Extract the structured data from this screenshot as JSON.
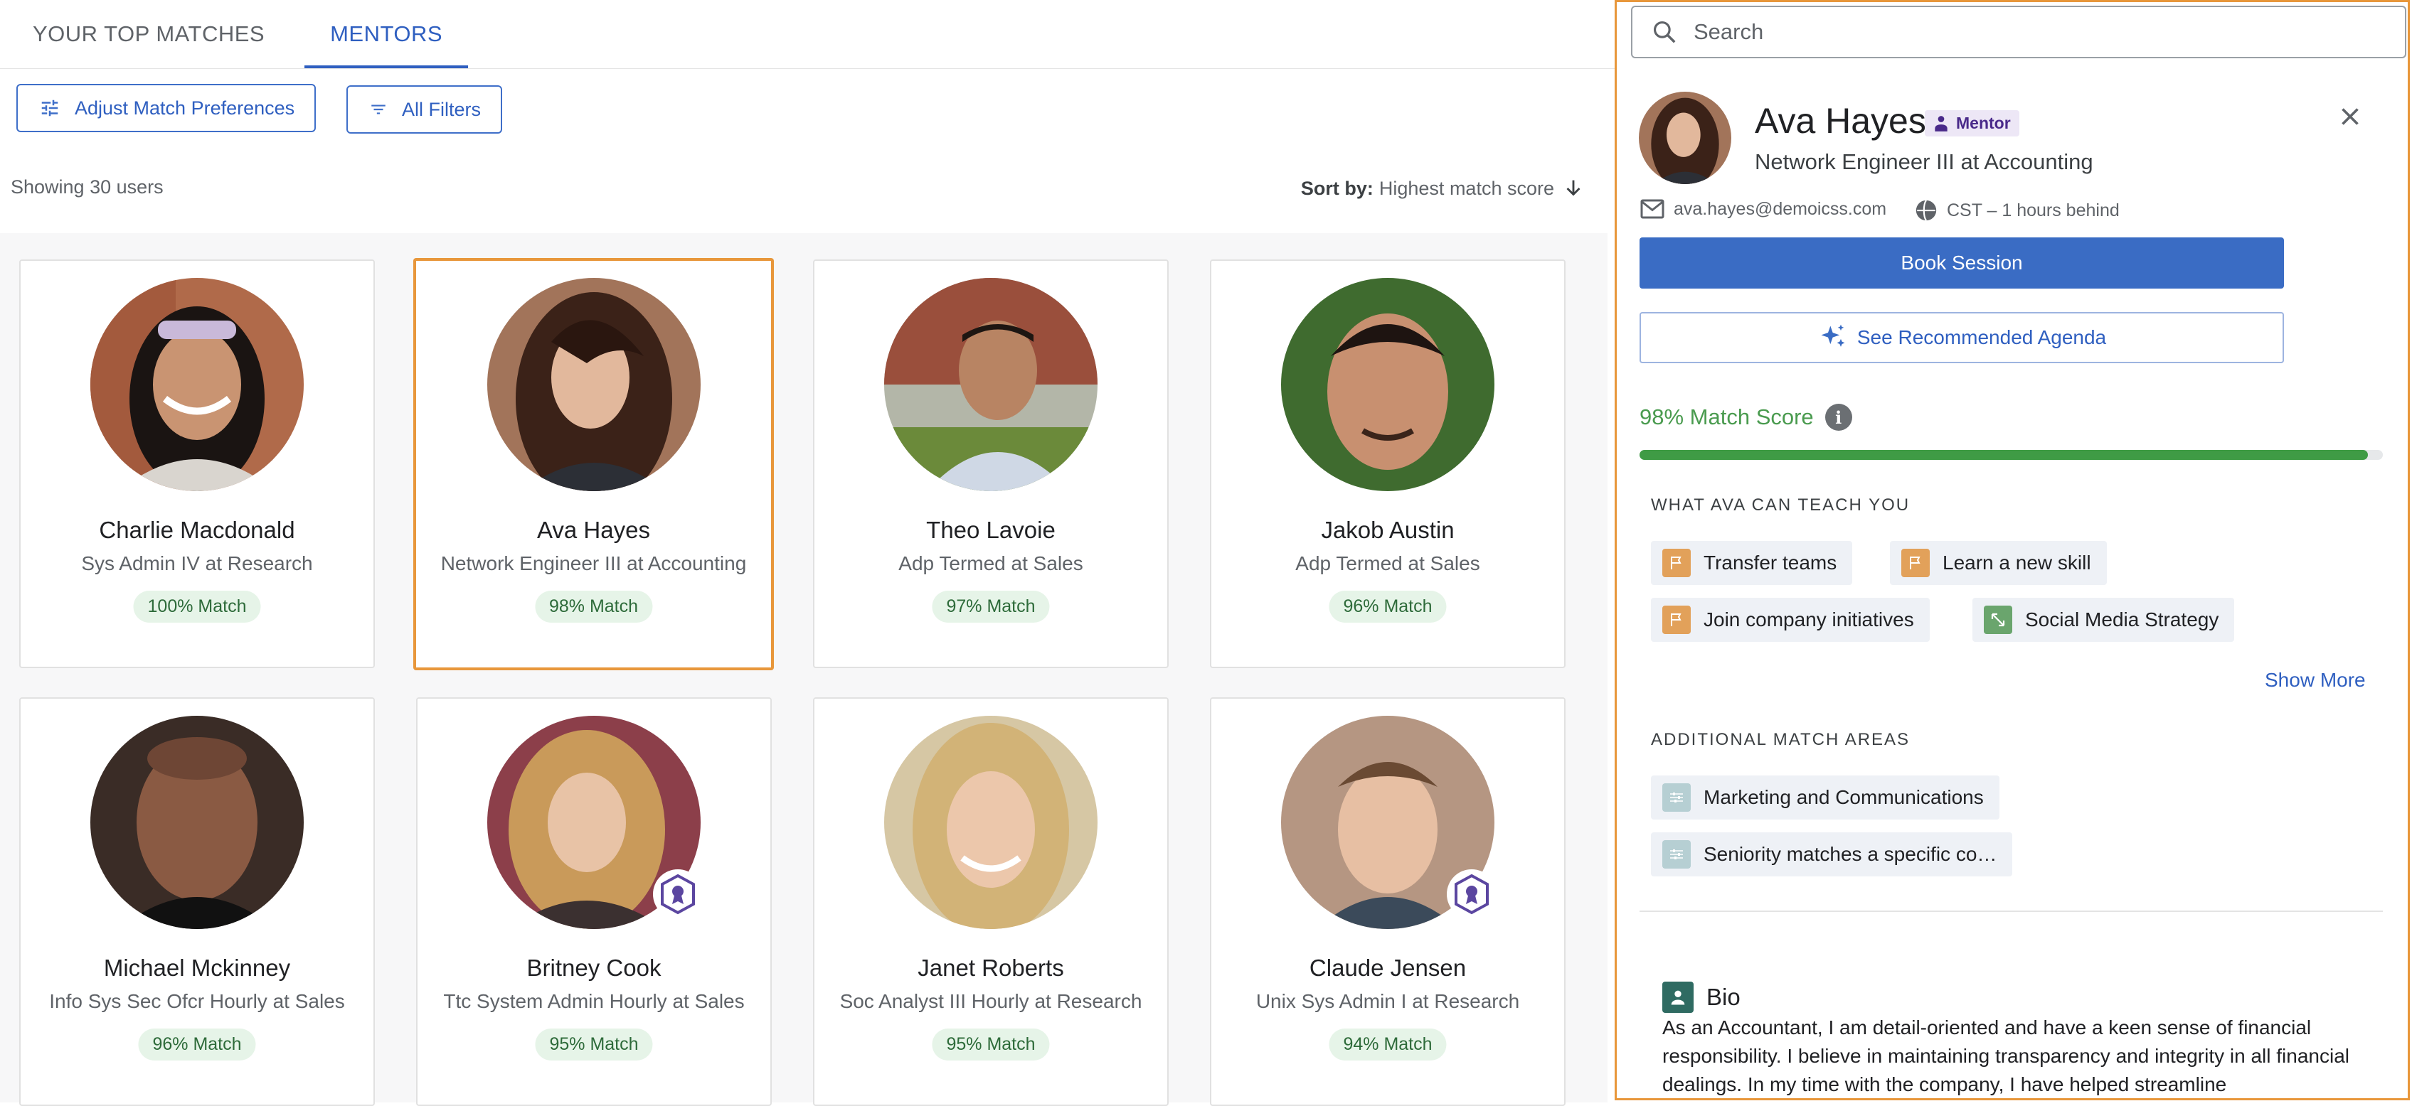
{
  "tabs": [
    {
      "label": "YOUR TOP MATCHES",
      "active": false
    },
    {
      "label": "MENTORS",
      "active": true
    }
  ],
  "toolbar": {
    "adjust_label": "Adjust Match Preferences",
    "filters_label": "All Filters",
    "showing_text": "Showing 30 users",
    "sort_label": "Sort by:",
    "sort_value": "Highest match score"
  },
  "cards": [
    {
      "name": "Charlie Macdonald",
      "role": "Sys Admin IV at Research",
      "match": "100% Match"
    },
    {
      "name": "Ava Hayes",
      "role": "Network Engineer III at Accounting",
      "match": "98% Match",
      "selected": true
    },
    {
      "name": "Theo Lavoie",
      "role": "Adp Termed at Sales",
      "match": "97% Match"
    },
    {
      "name": "Jakob Austin",
      "role": "Adp Termed at Sales",
      "match": "96% Match"
    },
    {
      "name": "Michael Mckinney",
      "role": "Info Sys Sec Ofcr Hourly at Sales",
      "match": "96% Match"
    },
    {
      "name": "Britney Cook",
      "role": "Ttc System Admin Hourly at Sales",
      "match": "95% Match",
      "badge": true
    },
    {
      "name": "Janet Roberts",
      "role": "Soc Analyst III Hourly at Research",
      "match": "95% Match"
    },
    {
      "name": "Claude Jensen",
      "role": "Unix Sys Admin I at Research",
      "match": "94% Match",
      "badge": true
    }
  ],
  "panel": {
    "search_placeholder": "Search",
    "name": "Ava Hayes",
    "tag": "Mentor",
    "role": "Network Engineer III at Accounting",
    "email": "ava.hayes@demoicss.com",
    "timezone": "CST – 1 hours behind",
    "book_label": "Book Session",
    "agenda_label": "See Recommended Agenda",
    "match_score": "98% Match Score",
    "match_fraction": 0.98,
    "teach_heading": "WHAT AVA CAN TEACH YOU",
    "teach_items": [
      {
        "label": "Transfer teams",
        "icon": "flag-icon"
      },
      {
        "label": "Learn a new skill",
        "icon": "flag-icon"
      },
      {
        "label": "Join company initiatives",
        "icon": "flag-icon"
      },
      {
        "label": "Social Media Strategy",
        "icon": "expand-icon"
      }
    ],
    "show_more": "Show More",
    "additional_heading": "ADDITIONAL MATCH AREAS",
    "additional_items": [
      {
        "label": "Marketing and Communications",
        "icon": "sliders-icon"
      },
      {
        "label": "Seniority matches a specific co…",
        "icon": "sliders-icon"
      }
    ],
    "bio_heading": "Bio",
    "bio_text": "As an Accountant, I am detail-oriented and have a keen sense of financial responsibility. I believe in maintaining transparency and integrity in all financial dealings. In my time with the company, I have helped streamline"
  },
  "colors": {
    "accent": "#2f5fc0",
    "selection": "#e8973b",
    "match_green": "#3f9b45"
  }
}
